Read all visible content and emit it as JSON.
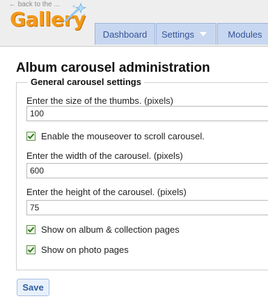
{
  "header": {
    "back_link": "← back to the ...",
    "logo_text": "Gallery",
    "colors": {
      "logo": "#f29a1a",
      "tab_bg": "#c8d7f0",
      "tab_text": "#35539a"
    }
  },
  "tabs": [
    {
      "label": "Dashboard"
    },
    {
      "label": "Settings",
      "icon": "chevron-down-icon"
    },
    {
      "label": "Modules"
    }
  ],
  "main": {
    "title": "Album carousel administration",
    "legend": "General carousel settings",
    "thumb_size": {
      "label": "Enter the size of the thumbs. (pixels)",
      "value": "100"
    },
    "mouseover": {
      "label": "Enable the mouseover to scroll carousel.",
      "checked": true
    },
    "carousel_width": {
      "label": "Enter the width of the carousel. (pixels)",
      "value": "600"
    },
    "carousel_height": {
      "label": "Enter the height of the carousel. (pixels)",
      "value": "75"
    },
    "album_pages": {
      "label": "Show on album & collection pages",
      "checked": true
    },
    "photo_pages": {
      "label": "Show on photo pages",
      "checked": true
    },
    "save_label": "Save"
  }
}
